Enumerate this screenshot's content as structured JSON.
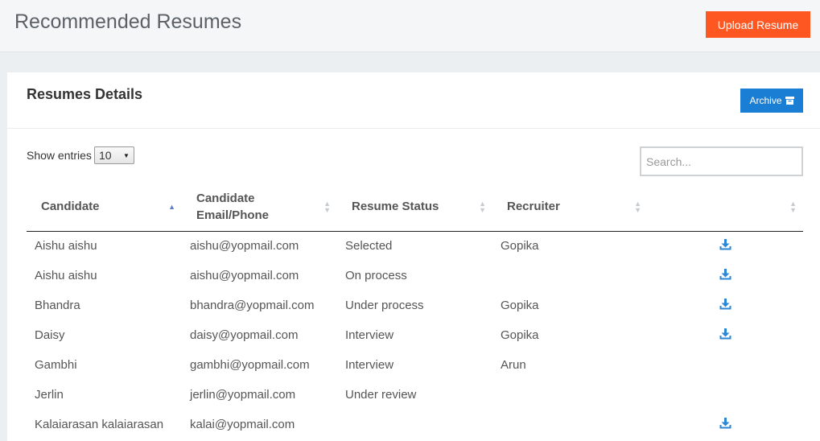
{
  "header": {
    "title": "Recommended Resumes",
    "upload_label": "Upload Resume",
    "accent": "#ff5722"
  },
  "card": {
    "title": "Resumes Details",
    "archive_label": "Archive",
    "archive_color": "#1a7fd4",
    "show_entries_label": "Show entries",
    "entries_value": "10",
    "search_placeholder": "Search..."
  },
  "table": {
    "columns": [
      "Candidate",
      "Candidate Email/Phone",
      "Resume Status",
      "Recruiter",
      ""
    ],
    "rows": [
      {
        "candidate": "Aishu aishu",
        "email": "aishu@yopmail.com",
        "status": "Selected",
        "recruiter": "Gopika",
        "download": true
      },
      {
        "candidate": "Aishu aishu",
        "email": "aishu@yopmail.com",
        "status": "On process",
        "recruiter": "",
        "download": true
      },
      {
        "candidate": "Bhandra",
        "email": "bhandra@yopmail.com",
        "status": "Under process",
        "recruiter": "Gopika",
        "download": true
      },
      {
        "candidate": "Daisy",
        "email": "daisy@yopmail.com",
        "status": "Interview",
        "recruiter": "Gopika",
        "download": true
      },
      {
        "candidate": "Gambhi",
        "email": "gambhi@yopmail.com",
        "status": "Interview",
        "recruiter": "Arun",
        "download": false
      },
      {
        "candidate": "Jerlin",
        "email": "jerlin@yopmail.com",
        "status": "Under review",
        "recruiter": "",
        "download": false
      },
      {
        "candidate": "Kalaiarasan kalaiarasan",
        "email": "kalai@yopmail.com",
        "status": "",
        "recruiter": "",
        "download": true
      }
    ]
  }
}
